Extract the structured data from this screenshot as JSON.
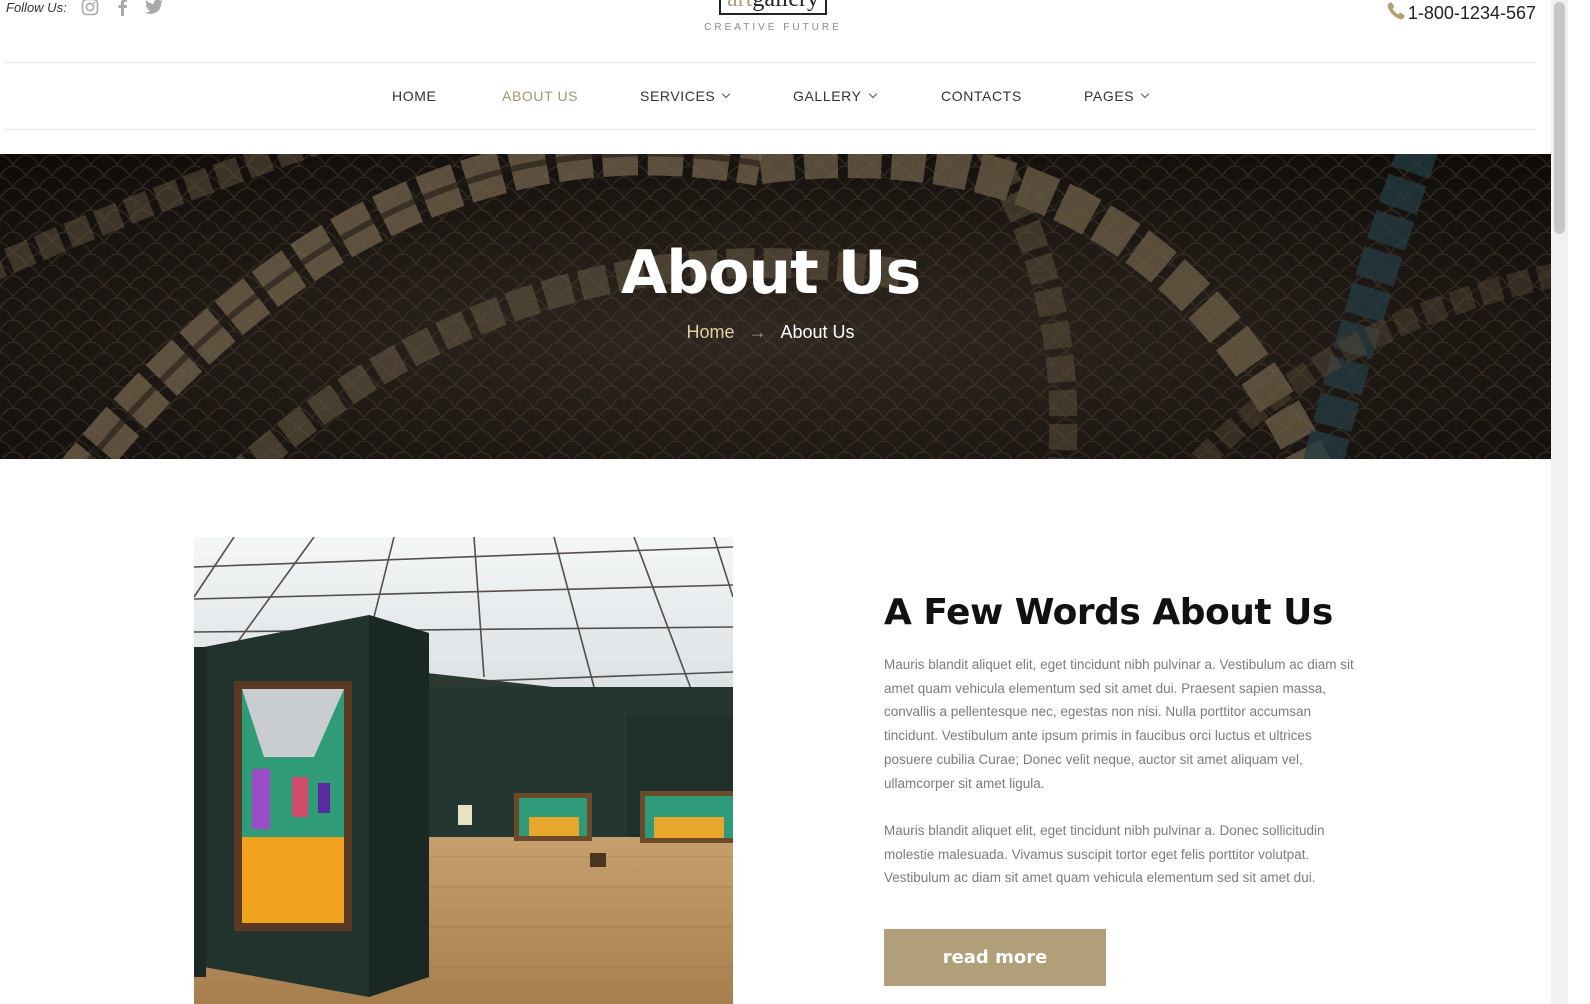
{
  "header": {
    "follow_label": "Follow Us:",
    "social_icons": [
      "instagram-icon",
      "facebook-icon",
      "twitter-icon"
    ],
    "logo": {
      "word1": "art",
      "word2": "gallery",
      "tagline": "CREATIVE FUTURE"
    },
    "phone": "1-800-1234-567"
  },
  "nav": {
    "items": [
      {
        "label": "HOME",
        "active": false,
        "dropdown": false
      },
      {
        "label": "ABOUT US",
        "active": true,
        "dropdown": false
      },
      {
        "label": "SERVICES",
        "active": false,
        "dropdown": true
      },
      {
        "label": "GALLERY",
        "active": false,
        "dropdown": true
      },
      {
        "label": "CONTACTS",
        "active": false,
        "dropdown": false
      },
      {
        "label": "PAGES",
        "active": false,
        "dropdown": true
      }
    ]
  },
  "hero": {
    "title": "About Us",
    "breadcrumb": {
      "home": "Home",
      "separator": "→",
      "current": "About Us"
    }
  },
  "about": {
    "title": "A Few Words About Us",
    "paragraphs": [
      "Mauris blandit aliquet elit, eget tincidunt nibh pulvinar a. Vestibulum ac diam sit amet quam vehicula elementum sed sit amet dui. Praesent sapien massa, convallis a pellentesque nec, egestas non nisi. Nulla porttitor accumsan tincidunt. Vestibulum ante ipsum primis in faucibus orci luctus et ultrices posuere cubilia Curae; Donec velit neque, auctor sit amet aliquam vel, ullamcorper sit amet ligula.",
      "Mauris blandit aliquet elit, eget tincidunt nibh pulvinar a. Donec sollicitudin molestie malesuada. Vivamus suscipit tortor eget felis porttitor volutpat. Vestibulum ac diam sit amet quam vehicula elementum sed sit amet dui."
    ],
    "button_label": "read more"
  },
  "colors": {
    "accent": "#b19f7a",
    "nav_active": "#a8946f",
    "breadcrumb_home": "#e2cfa2",
    "body_text": "#7c7c7c"
  }
}
